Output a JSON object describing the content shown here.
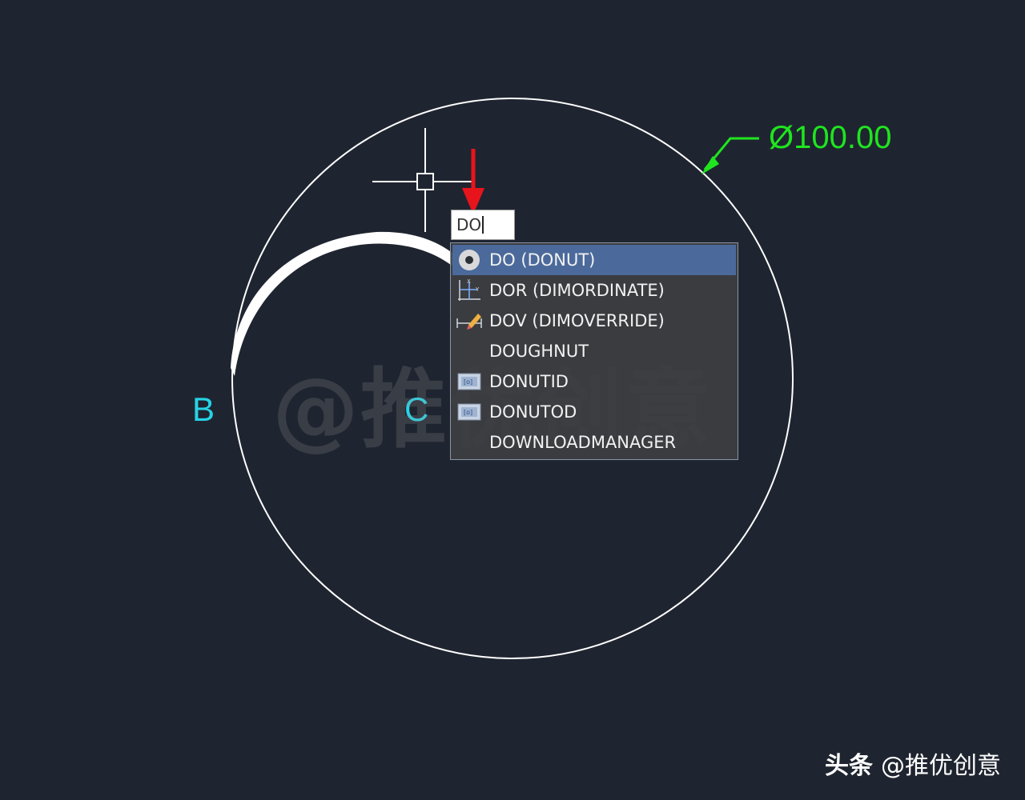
{
  "dimension": {
    "value": "Ø100.00",
    "color": "#1fe51f"
  },
  "points": {
    "b": "B",
    "c": "C",
    "color": "#27d3e6"
  },
  "command": {
    "typed": "DO"
  },
  "autocomplete": {
    "items": [
      {
        "label": "DO (DONUT)",
        "icon": "donut-icon",
        "selected": true
      },
      {
        "label": "DOR (DIMORDINATE)",
        "icon": "dimordinate-icon",
        "selected": false
      },
      {
        "label": "DOV (DIMOVERRIDE)",
        "icon": "dimoverride-icon",
        "selected": false
      },
      {
        "label": "DOUGHNUT",
        "icon": "",
        "selected": false
      },
      {
        "label": "DONUTID",
        "icon": "donut-id-icon",
        "selected": false
      },
      {
        "label": "DONUTOD",
        "icon": "donut-od-icon",
        "selected": false
      },
      {
        "label": "DOWNLOADMANAGER",
        "icon": "",
        "selected": false
      }
    ]
  },
  "watermark": "@推优创意",
  "footer": {
    "brand": "头条",
    "handle": "@推优创意"
  },
  "colors": {
    "background": "#1f2530",
    "geometry": "#ffffff",
    "arrow": "#e8141c",
    "menu_selected": "#4b6a9b"
  }
}
